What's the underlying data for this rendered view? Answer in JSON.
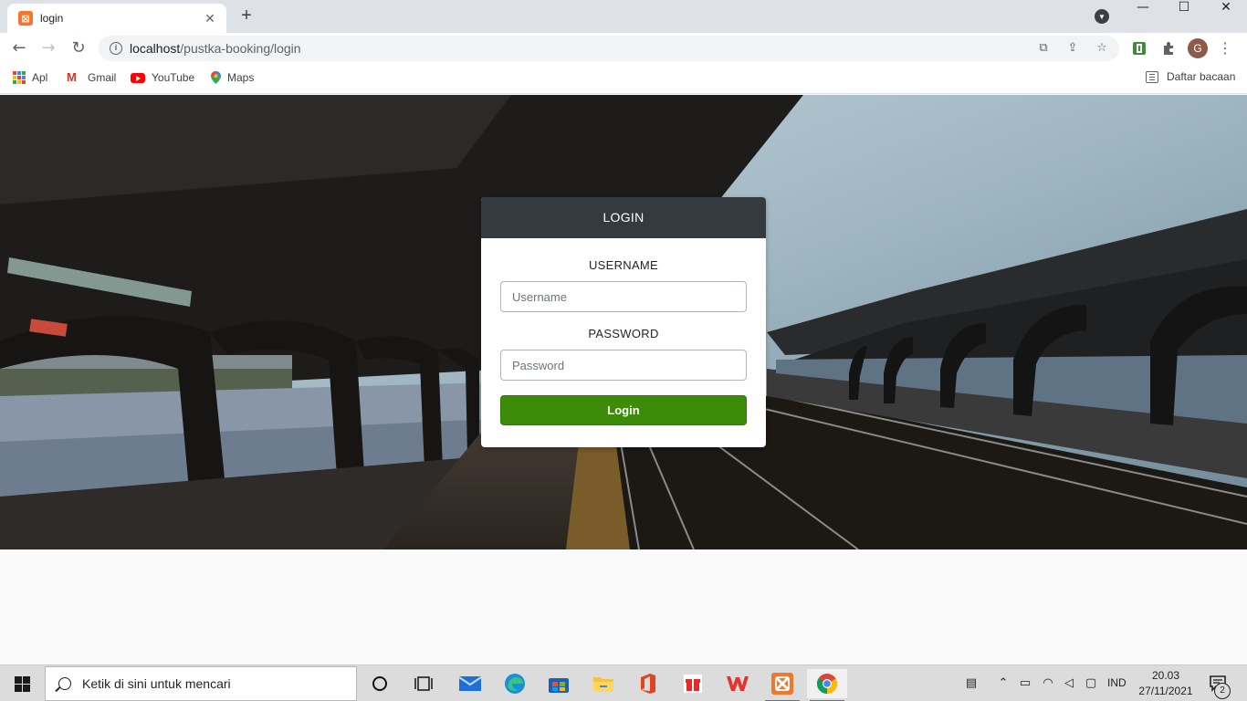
{
  "browser": {
    "tab_title": "login",
    "tab_favicon": "xampp-icon",
    "url_host": "localhost",
    "url_path": "/pustka-booking/login",
    "profile_initial": "G"
  },
  "bookmarks": {
    "items": [
      {
        "label": "Apl",
        "icon": "apps-icon"
      },
      {
        "label": "Gmail",
        "icon": "gmail-icon"
      },
      {
        "label": "YouTube",
        "icon": "youtube-icon"
      },
      {
        "label": "Maps",
        "icon": "maps-icon"
      }
    ],
    "reading_list": "Daftar bacaan"
  },
  "login": {
    "header": "LOGIN",
    "username_label": "USERNAME",
    "username_placeholder": "Username",
    "password_label": "PASSWORD",
    "password_placeholder": "Password",
    "button": "Login",
    "button_color": "#3c8c09",
    "header_color": "#343a40"
  },
  "taskbar": {
    "search_placeholder": "Ketik di sini untuk mencari",
    "language": "IND",
    "time": "20.03",
    "date": "27/11/2021",
    "notification_count": "2",
    "pinned": [
      "cortana-icon",
      "task-view-icon",
      "mail-icon",
      "edge-icon",
      "store-icon",
      "file-explorer-icon",
      "office-icon",
      "gift-icon",
      "wps-icon",
      "xampp-icon",
      "chrome-icon"
    ]
  }
}
